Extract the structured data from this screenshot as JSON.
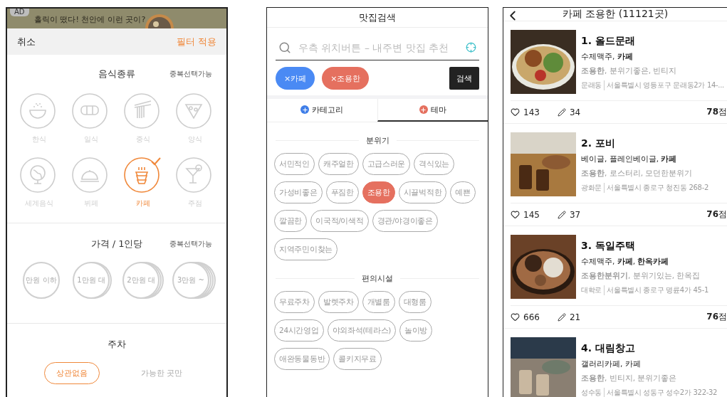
{
  "ad_banner": {
    "badge": "AD",
    "text": "홀릭이 떴다! 천안에 이런 곳이?"
  },
  "filter_panel": {
    "cancel": "취소",
    "apply": "필터 적용",
    "food_section": {
      "title": "음식종류",
      "note": "중복선택가능",
      "options": [
        {
          "label": "한식",
          "kind": "rice",
          "selected": false
        },
        {
          "label": "일식",
          "kind": "sushi",
          "selected": false
        },
        {
          "label": "중식",
          "kind": "noodle",
          "selected": false
        },
        {
          "label": "양식",
          "kind": "pizza",
          "selected": false
        },
        {
          "label": "세계음식",
          "kind": "globe",
          "selected": false
        },
        {
          "label": "뷔페",
          "kind": "cloche",
          "selected": false
        },
        {
          "label": "카페",
          "kind": "cup",
          "selected": true
        },
        {
          "label": "주점",
          "kind": "cocktail",
          "selected": false
        }
      ]
    },
    "price_section": {
      "title": "가격 / 1인당",
      "note": "중복선택가능",
      "options": [
        {
          "label": "만원 이하",
          "kind": "single",
          "selected": false
        },
        {
          "label": "1만원 대",
          "kind": "double",
          "selected": false
        },
        {
          "label": "2만원 대",
          "kind": "triple",
          "selected": false
        },
        {
          "label": "3만원 ~",
          "kind": "quad",
          "selected": false
        }
      ]
    },
    "parking_section": {
      "title": "주차",
      "options": [
        {
          "label": "상관없음",
          "selected": true
        },
        {
          "label": "가능한 곳만",
          "selected": false
        }
      ]
    }
  },
  "search_panel": {
    "title": "맛집검색",
    "search": {
      "placeholder": "우측 위치버튼 – 내주변 맛집 추천"
    },
    "chips": [
      {
        "label": "×카페",
        "color": "#4a8af4"
      },
      {
        "label": "×조용한",
        "color": "#e5705f"
      }
    ],
    "search_button": "검색",
    "tabs": [
      {
        "label": "카테고리",
        "selected": false,
        "color": "#3f7ee8"
      },
      {
        "label": "테마",
        "selected": true,
        "color": "#e5705f"
      }
    ],
    "groups": [
      {
        "title": "분위기",
        "tags": [
          {
            "label": "서민적인",
            "selected": false
          },
          {
            "label": "캐주얼한",
            "selected": false
          },
          {
            "label": "고급스러운",
            "selected": false
          },
          {
            "label": "격식있는",
            "selected": false
          },
          {
            "label": "가성비좋은",
            "selected": false
          },
          {
            "label": "푸짐한",
            "selected": false
          },
          {
            "label": "조용한",
            "selected": true
          },
          {
            "label": "시끌벅적한",
            "selected": false
          },
          {
            "label": "예쁜",
            "selected": false
          },
          {
            "label": "깔끔한",
            "selected": false
          },
          {
            "label": "이국적/이색적",
            "selected": false
          },
          {
            "label": "경관/야경이좋은",
            "selected": false
          },
          {
            "label": "지역주민이찾는",
            "selected": false
          }
        ]
      },
      {
        "title": "편의시설",
        "tags": [
          {
            "label": "무료주차",
            "selected": false
          },
          {
            "label": "발렛주차",
            "selected": false
          },
          {
            "label": "개별룸",
            "selected": false
          },
          {
            "label": "대형룸",
            "selected": false
          },
          {
            "label": "24시간영업",
            "selected": false
          },
          {
            "label": "야외좌석(테라스)",
            "selected": false
          },
          {
            "label": "놀이방",
            "selected": false
          },
          {
            "label": "애완동물동반",
            "selected": false
          },
          {
            "label": "콜키지무료",
            "selected": false
          }
        ]
      }
    ]
  },
  "results_panel": {
    "title": "카페 조용한 (11121곳)",
    "items": [
      {
        "name": "1. 올드문래",
        "categories": "수제맥주, **카페**",
        "tags": "**조용한**, 분위기좋은, 빈티지",
        "area": "문래동",
        "address": "서울특별시 영등포구 문래동2가 14-...",
        "likes": "143",
        "reviews": "34",
        "score": "**78**점"
      },
      {
        "name": "2. 포비",
        "categories": "베이글, 플레인베이글, **카페**",
        "tags": "**조용한**, 로스터리, 모던한분위기",
        "area": "광화문",
        "address": "서울특별시 종로구 청진동 268-2",
        "likes": "145",
        "reviews": "37",
        "score": "**76**점"
      },
      {
        "name": "3. 독일주택",
        "categories": "수제맥주, **카페**, **한옥카페**",
        "tags": "**조용한분위기**, 분위기있는, 한옥집",
        "area": "대학로",
        "address": "서울특별시 종로구 명륜4가 45-1",
        "likes": "666",
        "reviews": "21",
        "score": "**76**점"
      },
      {
        "name": "4. 대림창고",
        "categories": "갤러리카페, 카페",
        "tags": "**조용한**, 빈티지, 분위기좋은",
        "area": "성수동",
        "address": "서울특별시 성동구 성수2가 322-32"
      }
    ]
  }
}
